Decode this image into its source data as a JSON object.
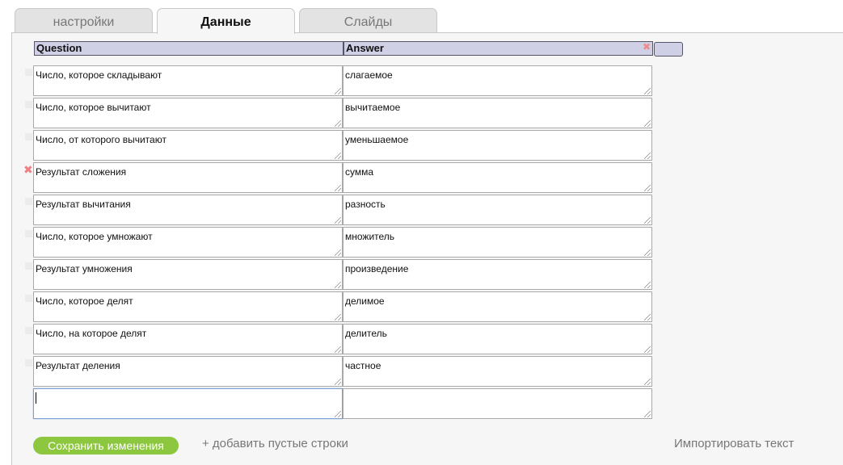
{
  "tabs": [
    {
      "label": "настройки",
      "active": false
    },
    {
      "label": "Данные",
      "active": true
    },
    {
      "label": "Слайды",
      "active": false
    }
  ],
  "table": {
    "headers": {
      "question": "Question",
      "answer": "Answer"
    },
    "rows": [
      {
        "question": "Число, которое складывают",
        "answer": "слагаемое"
      },
      {
        "question": "Число, которое вычитают",
        "answer": "вычитаемое"
      },
      {
        "question": "Число, от которого вычитают",
        "answer": "уменьшаемое"
      },
      {
        "question": "Результат сложения",
        "answer": "сумма"
      },
      {
        "question": "Результат вычитания",
        "answer": "разность"
      },
      {
        "question": "Число, которое умножают",
        "answer": "множитель"
      },
      {
        "question": "Результат умножения",
        "answer": "произведение"
      },
      {
        "question": "Число, которое делят",
        "answer": "делимое"
      },
      {
        "question": "Число, на которое делят",
        "answer": "делитель"
      },
      {
        "question": "Результат деления",
        "answer": "частное"
      },
      {
        "question": "",
        "answer": ""
      }
    ]
  },
  "footer": {
    "save_label": "Сохранить изменения",
    "add_rows_label": "+ добавить пустые строки",
    "import_label": "Импортировать текст"
  },
  "colors": {
    "accent_green": "#8dc63f",
    "header_bg": "#cfcfe6",
    "delete_red": "#ee8080"
  }
}
